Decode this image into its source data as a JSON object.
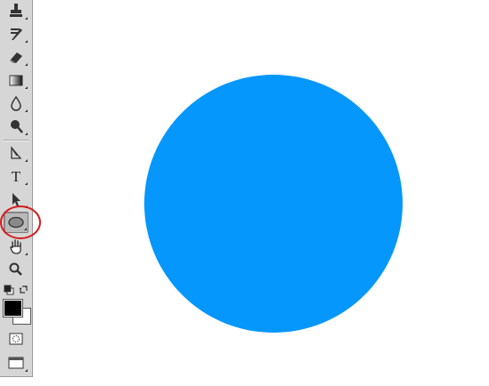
{
  "toolbar": {
    "tools": [
      {
        "name": "clone-stamp-tool",
        "icon": "stamp-icon"
      },
      {
        "name": "history-brush-tool",
        "icon": "history-brush-icon"
      },
      {
        "name": "eraser-tool",
        "icon": "eraser-icon"
      },
      {
        "name": "gradient-tool",
        "icon": "gradient-icon"
      },
      {
        "name": "blur-tool",
        "icon": "drop-icon"
      },
      {
        "name": "dodge-tool",
        "icon": "dodge-icon"
      },
      {
        "name": "pen-tool",
        "icon": "pen-icon"
      },
      {
        "name": "type-tool",
        "icon": "type-icon",
        "label": "T"
      },
      {
        "name": "path-selection-tool",
        "icon": "arrow-icon"
      },
      {
        "name": "ellipse-tool",
        "icon": "ellipse-icon",
        "active": true
      },
      {
        "name": "hand-tool",
        "icon": "hand-icon"
      },
      {
        "name": "zoom-tool",
        "icon": "magnifier-icon"
      }
    ],
    "foreground_color": "#000000",
    "background_color": "#ffffff",
    "highlight_color": "#d71b1b"
  },
  "canvas": {
    "shape": "ellipse",
    "fill_color": "#0597fb"
  }
}
